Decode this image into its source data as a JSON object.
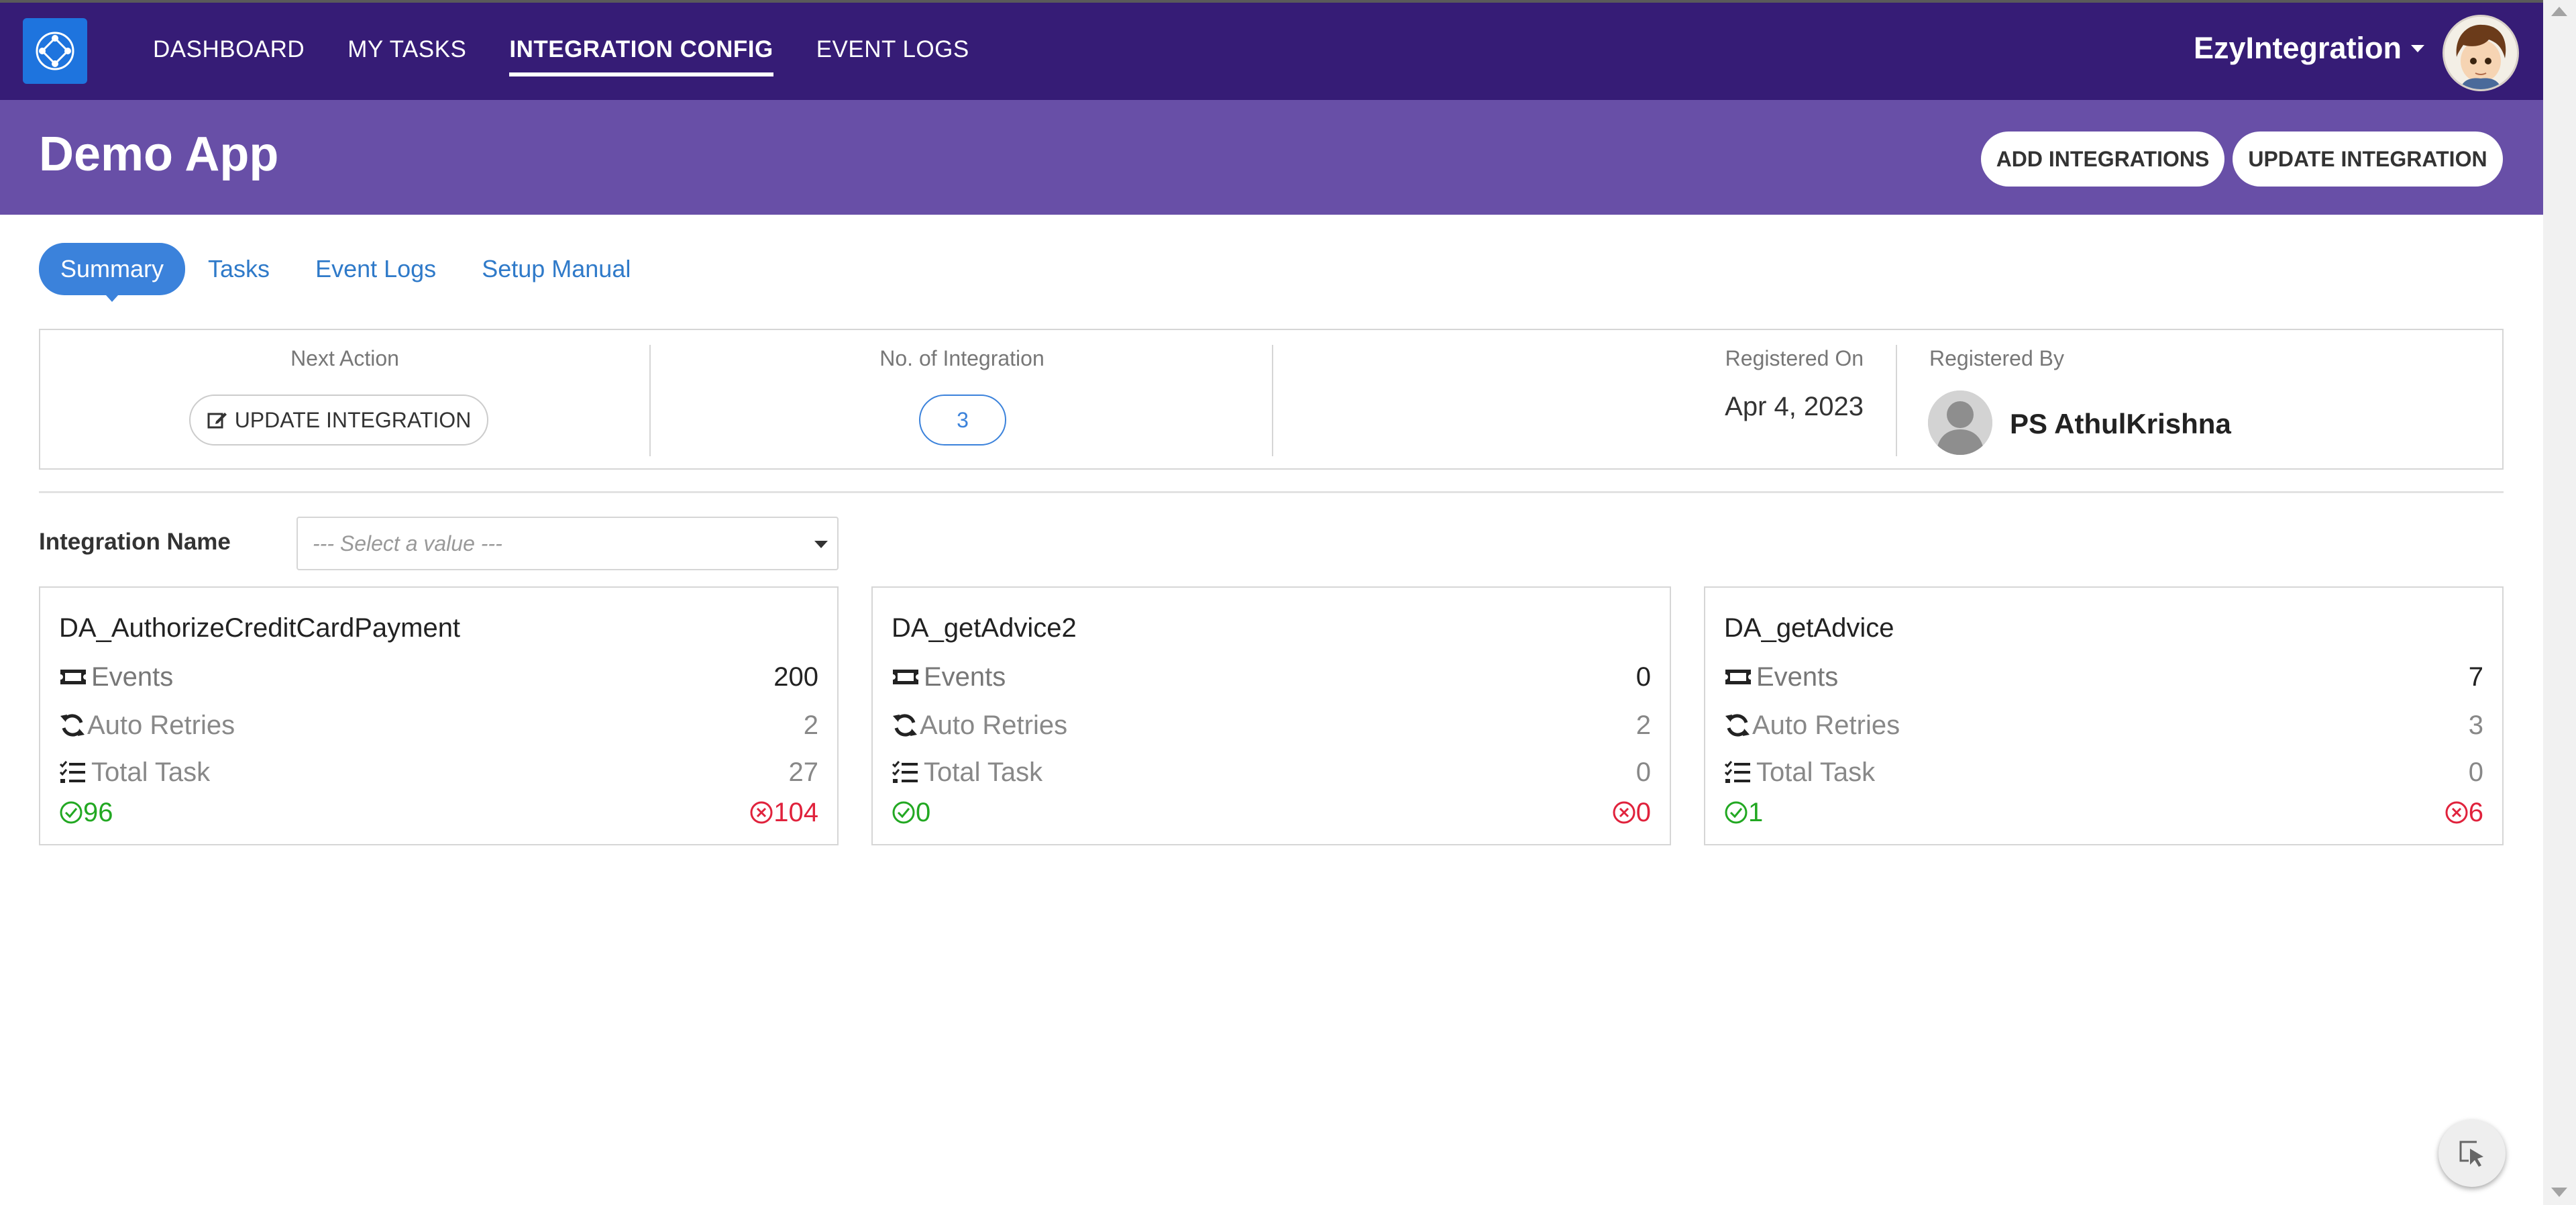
{
  "nav": {
    "logo_icon": "integration-hub-icon",
    "links": [
      {
        "label": "DASHBOARD",
        "active": false
      },
      {
        "label": "MY TASKS",
        "active": false
      },
      {
        "label": "INTEGRATION CONFIG",
        "active": true
      },
      {
        "label": "EVENT LOGS",
        "active": false
      }
    ],
    "brand": "EzyIntegration"
  },
  "header": {
    "title": "Demo App",
    "add_button": "ADD INTEGRATIONS",
    "update_button": "UPDATE INTEGRATION"
  },
  "subtabs": [
    {
      "label": "Summary",
      "active": true
    },
    {
      "label": "Tasks",
      "active": false
    },
    {
      "label": "Event Logs",
      "active": false
    },
    {
      "label": "Setup Manual",
      "active": false
    }
  ],
  "summary": {
    "next_action_label": "Next Action",
    "next_action_button": "UPDATE INTEGRATION",
    "integration_count_label": "No. of Integration",
    "integration_count": "3",
    "registered_on_label": "Registered On",
    "registered_on": "Apr 4, 2023",
    "registered_by_label": "Registered By",
    "registered_by": "PS AthulKrishna"
  },
  "filter": {
    "label": "Integration Name",
    "placeholder": "--- Select a value ---"
  },
  "cards": [
    {
      "name": "DA_AuthorizeCreditCardPayment",
      "events_label": "Events",
      "events": "200",
      "retries_label": "Auto Retries",
      "retries": "2",
      "tasks_label": "Total Task",
      "tasks": "27",
      "success": "96",
      "failed": "104"
    },
    {
      "name": "DA_getAdvice2",
      "events_label": "Events",
      "events": "0",
      "retries_label": "Auto Retries",
      "retries": "2",
      "tasks_label": "Total Task",
      "tasks": "0",
      "success": "0",
      "failed": "0"
    },
    {
      "name": "DA_getAdvice",
      "events_label": "Events",
      "events": "7",
      "retries_label": "Auto Retries",
      "retries": "3",
      "tasks_label": "Total Task",
      "tasks": "0",
      "success": "1",
      "failed": "6"
    }
  ],
  "colors": {
    "nav_bg": "#361c76",
    "header_bg": "#684fa7",
    "accent": "#3b82db",
    "success": "#22a822",
    "error": "#e0223c"
  }
}
